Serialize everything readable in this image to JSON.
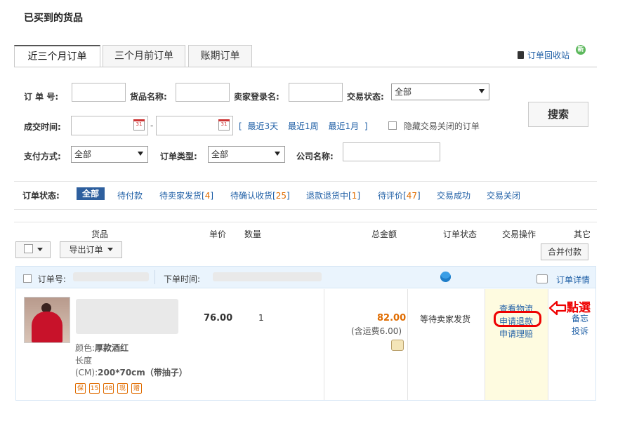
{
  "page_title": "已买到的货品",
  "tabs": [
    {
      "label": "近三个月订单"
    },
    {
      "label": "三个月前订单"
    },
    {
      "label": "账期订单"
    }
  ],
  "recycle_link": "订单回收站",
  "recycle_badge": "新",
  "filters": {
    "order_no_label": "订 单 号:",
    "product_name_label": "货品名称:",
    "seller_login_label": "卖家登录名:",
    "trade_status_label": "交易状态:",
    "trade_status_value": "全部",
    "deal_time_label": "成交时间:",
    "date_sep": "-",
    "calendar_day": "31",
    "quick_open": "[",
    "quick_3days": "最近3天",
    "quick_1week": "最近1周",
    "quick_1month": "最近1月",
    "quick_close": "]",
    "hide_closed_label": "隐藏交易关闭的订单",
    "payment_label": "支付方式:",
    "payment_value": "全部",
    "order_type_label": "订单类型:",
    "order_type_value": "全部",
    "company_label": "公司名称:",
    "search_button": "搜索"
  },
  "status_bar": {
    "label": "订单状态:",
    "items": [
      {
        "label": "全部",
        "count": ""
      },
      {
        "label": "待付款",
        "count": ""
      },
      {
        "label": "待卖家发货",
        "count": "4"
      },
      {
        "label": "待确认收货",
        "count": "25"
      },
      {
        "label": "退款退货中",
        "count": "1"
      },
      {
        "label": "待评价",
        "count": "47"
      },
      {
        "label": "交易成功",
        "count": ""
      },
      {
        "label": "交易关闭",
        "count": ""
      }
    ]
  },
  "table": {
    "headers": [
      "货品",
      "单价",
      "数量",
      "总金额",
      "订单状态",
      "交易操作",
      "其它"
    ],
    "export_button": "导出订单",
    "merge_pay_button": "合并付款"
  },
  "order": {
    "order_no_label": "订单号:",
    "order_time_label": "下单时间:",
    "detail_link": "订单详情",
    "color_label": "颜色:",
    "color_value": "厚款酒红",
    "length_label": "长度(CM):",
    "length_value": "200*70cm（带抽子）",
    "unit_price": "76.00",
    "quantity": "1",
    "total": "82.00",
    "shipping_note": "(含运费6.00)",
    "status": "等待卖家发货",
    "op_logistics": "查看物流",
    "op_refund": "申请退款",
    "op_claim": "申请理赔",
    "other_note": "备忘",
    "other_complain": "投诉",
    "service_tags": [
      "保",
      "15",
      "48",
      "现",
      "赠"
    ]
  },
  "annotation": "點選",
  "colors": {
    "accent_blue": "#1f5fa6",
    "orange": "#e06c00",
    "annotation_red": "#e00000",
    "ops_bg": "#fefbe0"
  }
}
